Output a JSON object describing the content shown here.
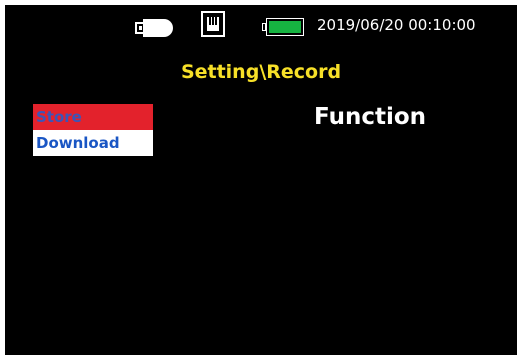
{
  "status_bar": {
    "usb_icon": "usb-drive-icon",
    "network_icon": "ethernet-port-icon",
    "battery_icon": "battery-icon",
    "battery_level": 1.0,
    "battery_color": "#16b341",
    "datetime": "2019/06/20 00:10:00"
  },
  "page": {
    "title": "Setting\\Record",
    "title_color": "#f7e028",
    "function_label": "Function"
  },
  "menu": {
    "items": [
      {
        "label": "Store",
        "selected": true
      },
      {
        "label": "Download",
        "selected": false
      }
    ],
    "selected_bg": "#e3222c",
    "selected_text": "#3c55b8",
    "normal_bg": "#ffffff",
    "normal_text": "#1a56c4"
  }
}
